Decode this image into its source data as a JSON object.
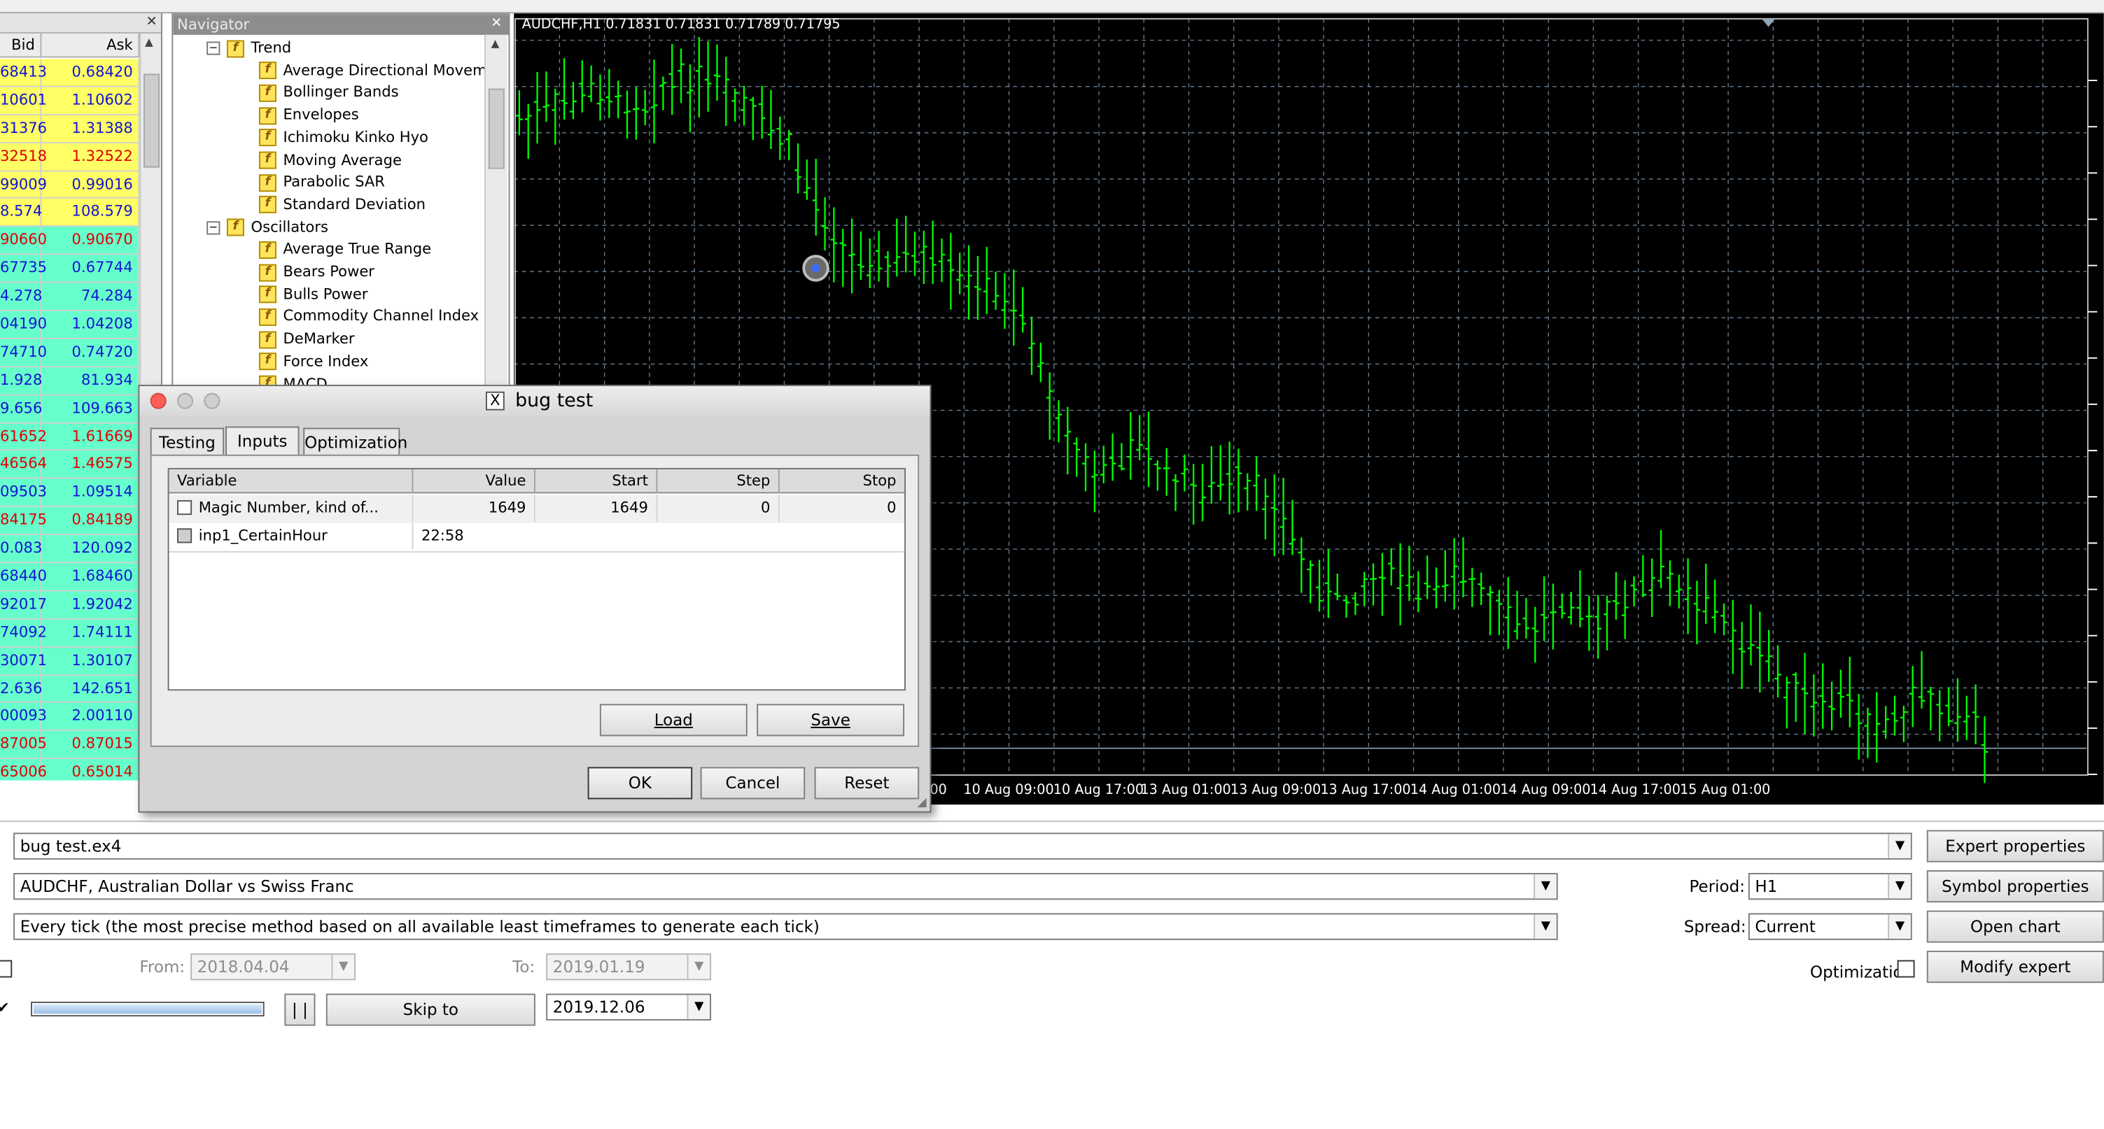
{
  "market_watch": {
    "headers": {
      "bid": "Bid",
      "ask": "Ask"
    },
    "rows": [
      {
        "bid": "68413",
        "ask": "0.68420",
        "bg": "#ffff66",
        "color": "#1414d2"
      },
      {
        "bid": "10601",
        "ask": "1.10602",
        "bg": "#ffff66",
        "color": "#1414d2"
      },
      {
        "bid": "31376",
        "ask": "1.31388",
        "bg": "#ffff66",
        "color": "#1414d2"
      },
      {
        "bid": "32518",
        "ask": "1.32522",
        "bg": "#ffff66",
        "color": "#e00000"
      },
      {
        "bid": "99009",
        "ask": "0.99016",
        "bg": "#ffff66",
        "color": "#1414d2"
      },
      {
        "bid": "8.574",
        "ask": "108.579",
        "bg": "#ffff66",
        "color": "#1414d2"
      },
      {
        "bid": "90660",
        "ask": "0.90670",
        "bg": "#66ffcc",
        "color": "#e00000"
      },
      {
        "bid": "67735",
        "ask": "0.67744",
        "bg": "#66ffcc",
        "color": "#1414d2"
      },
      {
        "bid": "4.278",
        "ask": "74.284",
        "bg": "#66ffcc",
        "color": "#1414d2"
      },
      {
        "bid": "04190",
        "ask": "1.04208",
        "bg": "#66ffcc",
        "color": "#1414d2"
      },
      {
        "bid": "74710",
        "ask": "0.74720",
        "bg": "#66ffcc",
        "color": "#1414d2"
      },
      {
        "bid": "1.928",
        "ask": "81.934",
        "bg": "#66ffcc",
        "color": "#1414d2"
      },
      {
        "bid": "9.656",
        "ask": "109.663",
        "bg": "#66ffcc",
        "color": "#1414d2"
      },
      {
        "bid": "61652",
        "ask": "1.61669",
        "bg": "#66ffcc",
        "color": "#e00000"
      },
      {
        "bid": "46564",
        "ask": "1.46575",
        "bg": "#66ffcc",
        "color": "#e00000"
      },
      {
        "bid": "09503",
        "ask": "1.09514",
        "bg": "#66ffcc",
        "color": "#1414d2"
      },
      {
        "bid": "84175",
        "ask": "0.84189",
        "bg": "#66ffcc",
        "color": "#e00000"
      },
      {
        "bid": "0.083",
        "ask": "120.092",
        "bg": "#66ffcc",
        "color": "#1414d2"
      },
      {
        "bid": "68440",
        "ask": "1.68460",
        "bg": "#66ffcc",
        "color": "#1414d2"
      },
      {
        "bid": "92017",
        "ask": "1.92042",
        "bg": "#66ffcc",
        "color": "#1414d2"
      },
      {
        "bid": "74092",
        "ask": "1.74111",
        "bg": "#66ffcc",
        "color": "#1414d2"
      },
      {
        "bid": "30071",
        "ask": "1.30107",
        "bg": "#66ffcc",
        "color": "#1414d2"
      },
      {
        "bid": "2.636",
        "ask": "142.651",
        "bg": "#66ffcc",
        "color": "#1414d2"
      },
      {
        "bid": "00093",
        "ask": "2.00110",
        "bg": "#66ffcc",
        "color": "#1414d2"
      },
      {
        "bid": "87005",
        "ask": "0.87015",
        "bg": "#66ffcc",
        "color": "#e00000"
      },
      {
        "bid": "65006",
        "ask": "0.65014",
        "bg": "#66ffcc",
        "color": "#e00000"
      }
    ]
  },
  "navigator": {
    "title": "Navigator",
    "groups": [
      {
        "label": "Trend",
        "items": [
          "Average Directional Movemen",
          "Bollinger Bands",
          "Envelopes",
          "Ichimoku Kinko Hyo",
          "Moving Average",
          "Parabolic SAR",
          "Standard Deviation"
        ]
      },
      {
        "label": "Oscillators",
        "items": [
          "Average True Range",
          "Bears Power",
          "Bulls Power",
          "Commodity Channel Index",
          "DeMarker",
          "Force Index",
          "MACD"
        ]
      }
    ]
  },
  "chart": {
    "header": "AUDCHF,H1  0.71831 0.71831 0.71789 0.71795",
    "x_labels": [
      "00",
      "10 Aug 09:00",
      "10 Aug 17:00",
      "13 Aug 01:00",
      "13 Aug 09:00",
      "13 Aug 17:00",
      "14 Aug 01:00",
      "14 Aug 09:00",
      "14 Aug 17:00",
      "15 Aug 01:00"
    ],
    "colors": {
      "background": "#000000",
      "bars": "#00ff00",
      "grid": "#6b7f92",
      "text": "#ffffff"
    }
  },
  "chart_data": {
    "type": "ohlc",
    "title": "AUDCHF,H1  0.71831 0.71831 0.71789 0.71795",
    "symbol": "AUDCHF",
    "timeframe": "H1",
    "last_ohlc": {
      "open": 0.71831,
      "high": 0.71831,
      "low": 0.71789,
      "close": 0.71795
    },
    "x_tick_labels": [
      "00",
      "10 Aug 09:00",
      "10 Aug 17:00",
      "13 Aug 01:00",
      "13 Aug 09:00",
      "13 Aug 17:00",
      "14 Aug 01:00",
      "14 Aug 09:00",
      "14 Aug 17:00",
      "15 Aug 01:00"
    ],
    "grid": true,
    "bar_color": "#00ff00",
    "background": "#000000",
    "path_anchors": [
      [
        0,
        80
      ],
      [
        4,
        70
      ],
      [
        8,
        58
      ],
      [
        13,
        70
      ],
      [
        17,
        50
      ],
      [
        21,
        52
      ],
      [
        25,
        70
      ],
      [
        29,
        90
      ],
      [
        33,
        140
      ],
      [
        37,
        182
      ],
      [
        40,
        188
      ],
      [
        44,
        180
      ],
      [
        48,
        196
      ],
      [
        52,
        206
      ],
      [
        56,
        226
      ],
      [
        60,
        300
      ],
      [
        64,
        350
      ],
      [
        68,
        320
      ],
      [
        72,
        345
      ],
      [
        76,
        356
      ],
      [
        80,
        350
      ],
      [
        84,
        366
      ],
      [
        88,
        420
      ],
      [
        92,
        440
      ],
      [
        96,
        412
      ],
      [
        100,
        432
      ],
      [
        104,
        414
      ],
      [
        108,
        440
      ],
      [
        112,
        460
      ],
      [
        116,
        434
      ],
      [
        120,
        456
      ],
      [
        124,
        434
      ],
      [
        128,
        420
      ],
      [
        132,
        440
      ],
      [
        136,
        470
      ],
      [
        140,
        490
      ],
      [
        144,
        520
      ],
      [
        148,
        516
      ],
      [
        152,
        530
      ],
      [
        156,
        506
      ],
      [
        160,
        520
      ],
      [
        164,
        546
      ]
    ]
  },
  "dialog": {
    "title": "bug test",
    "tabs": [
      "Testing",
      "Inputs",
      "Optimization"
    ],
    "active_tab": "Inputs",
    "columns": [
      "Variable",
      "Value",
      "Start",
      "Step",
      "Stop"
    ],
    "rows": [
      {
        "variable": "Magic Number, kind of...",
        "value": "1649",
        "start": "1649",
        "step": "0",
        "stop": "0"
      },
      {
        "variable": "inp1_CertainHour",
        "value": "22:58",
        "start": "",
        "step": "",
        "stop": ""
      }
    ],
    "load_label": "Load",
    "save_label": "Save",
    "ok_label": "OK",
    "cancel_label": "Cancel",
    "reset_label": "Reset"
  },
  "tester": {
    "expert": "bug test.ex4",
    "symbol": "AUDCHF, Australian Dollar vs Swiss Franc",
    "model": "Every tick (the most precise method based on all available least timeframes to generate each tick)",
    "period_label": "Period:",
    "period_value": "H1",
    "spread_label": "Spread:",
    "spread_value": "Current",
    "from_label": "From:",
    "from_value": "2018.04.04",
    "to_label": "To:",
    "to_value": "2019.01.19",
    "optimization_label": "Optimization",
    "pause_label": "| |",
    "skip_label": "Skip to",
    "skip_date": "2019.12.06",
    "progress": 1.0,
    "buttons": {
      "expert_properties": "Expert properties",
      "symbol_properties": "Symbol properties",
      "open_chart": "Open chart",
      "modify_expert": "Modify expert"
    }
  }
}
